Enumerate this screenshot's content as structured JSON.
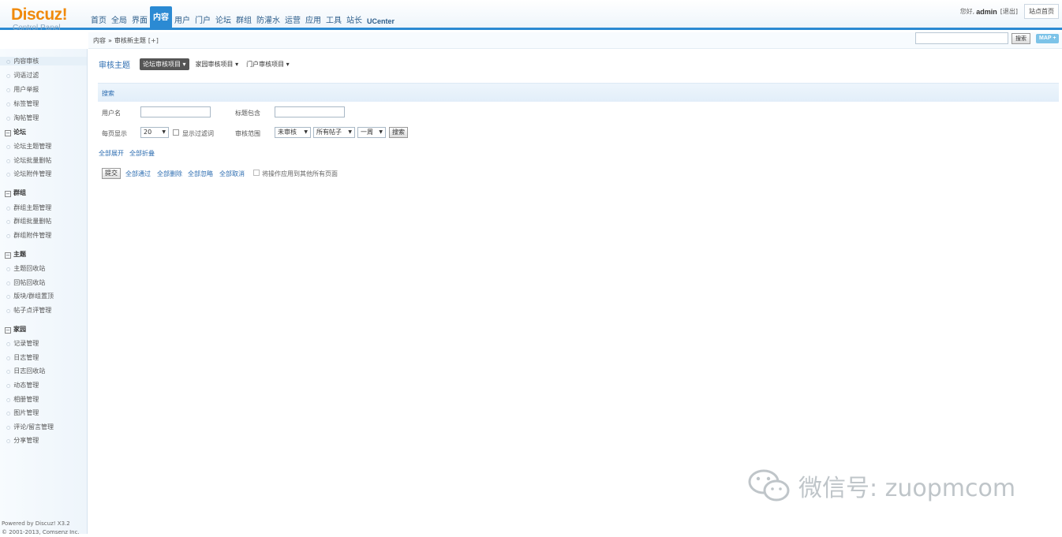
{
  "header": {
    "logo": "Discuz!",
    "logo_sub": "Control Panel",
    "nav": [
      "首页",
      "全局",
      "界面",
      "内容",
      "用户",
      "门户",
      "论坛",
      "群组",
      "防灌水",
      "运营",
      "应用",
      "工具",
      "站长",
      "UCenter"
    ],
    "active_nav": "内容",
    "greeting": "您好,",
    "username": "admin",
    "logout": "[退出]",
    "home_button": "站点首页"
  },
  "subheader": {
    "crumb_root": "内容",
    "crumb_sep": "»",
    "crumb_page": "审核新主题",
    "crumb_add": "[+]",
    "search_placeholder": "",
    "search_button": "搜索",
    "map_button": "MAP +"
  },
  "sidebar": {
    "top_items": [
      "内容审核",
      "词语过滤",
      "用户举报",
      "标签管理",
      "淘帖管理"
    ],
    "groups": [
      {
        "title": "论坛",
        "items": [
          "论坛主题管理",
          "论坛批量删帖",
          "论坛附件管理"
        ]
      },
      {
        "title": "群组",
        "items": [
          "群组主题管理",
          "群组批量删帖",
          "群组附件管理"
        ]
      },
      {
        "title": "主题",
        "items": [
          "主题回收站",
          "回帖回收站",
          "版块/群组置顶",
          "帖子点评管理"
        ]
      },
      {
        "title": "家园",
        "items": [
          "记录管理",
          "日志管理",
          "日志回收站",
          "动态管理",
          "相册管理",
          "图片管理",
          "评论/留言管理",
          "分享管理"
        ]
      }
    ],
    "footer_line1": "Powered by Discuz! X3.2",
    "footer_line2": "© 2001-2013, Comsenz Inc."
  },
  "main": {
    "title": "审核主题",
    "tabs": [
      "论坛审核项目 ▾",
      "家园审核项目 ▾",
      "门户审核项目 ▾"
    ],
    "search_section": "搜索",
    "username_label": "用户名",
    "title_contains_label": "标题包含",
    "per_page_label": "每页显示",
    "per_page_value": "20",
    "show_filtered_label": "显示过滤词",
    "audit_range_label": "审核范围",
    "status_select": "未审核",
    "post_select": "所有帖子",
    "time_select": "一周",
    "search_button": "搜索",
    "expand_all": "全部展开",
    "collapse_all": "全部折叠",
    "submit_button": "提交",
    "bulk_actions": [
      "全部通过",
      "全部删除",
      "全部忽略",
      "全部取消"
    ],
    "apply_all_label": "将操作应用到其他所有页面"
  },
  "watermark": {
    "text": "微信号: zuopmcom"
  },
  "colors": {
    "brand_orange": "#f08a0c",
    "accent_blue": "#2b8ad3",
    "link_blue": "#2c6cb0"
  }
}
